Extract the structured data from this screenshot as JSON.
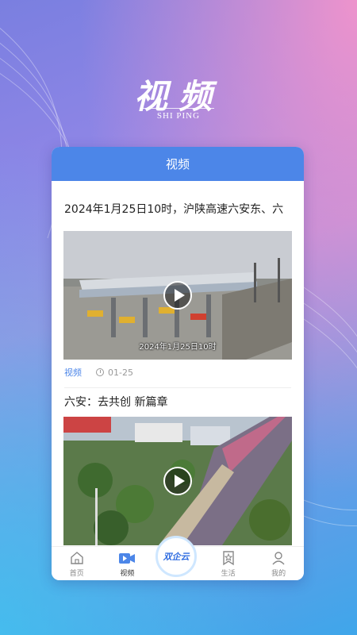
{
  "header": {
    "title": "视频",
    "subtitle": "SHI PING"
  },
  "card": {
    "title": "视频"
  },
  "feed": {
    "items": [
      {
        "title": "2024年1月25日10时，沪陕高速六安东、六",
        "caption": "2024年1月25日10时",
        "tag": "视频",
        "date": "01-25"
      },
      {
        "title": "六安：去共创 新篇章"
      }
    ]
  },
  "tabbar": {
    "items": [
      {
        "label": "首页",
        "icon": "home-icon"
      },
      {
        "label": "视频",
        "icon": "video-icon",
        "active": true
      },
      {
        "label": "",
        "icon": "center-logo"
      },
      {
        "label": "生活",
        "icon": "bookmark-star-icon"
      },
      {
        "label": "我的",
        "icon": "user-icon"
      }
    ],
    "center_label": "双企云"
  },
  "colors": {
    "accent": "#4c86e8",
    "tag": "#4c86e8"
  }
}
